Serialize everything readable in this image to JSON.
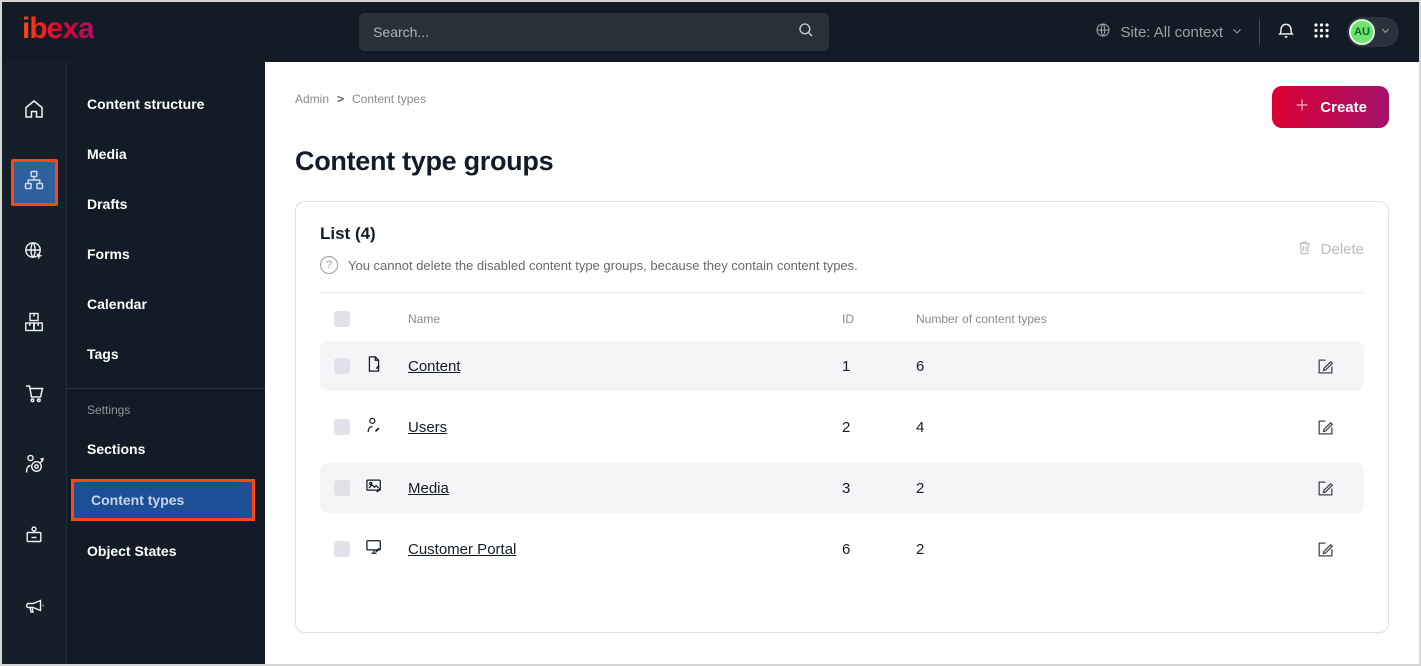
{
  "topbar": {
    "logo_text": "ibexa",
    "search_placeholder": "Search...",
    "site_context": "Site: All context",
    "avatar_initials": "AU"
  },
  "rail": {
    "items": [
      {
        "name": "home"
      },
      {
        "name": "content-structure",
        "active": true
      },
      {
        "name": "site"
      },
      {
        "name": "product-catalog"
      },
      {
        "name": "commerce"
      },
      {
        "name": "personalization"
      },
      {
        "name": "admin"
      },
      {
        "name": "marketing"
      }
    ]
  },
  "menu": {
    "items": [
      "Content structure",
      "Media",
      "Drafts",
      "Forms",
      "Calendar",
      "Tags"
    ],
    "settings_label": "Settings",
    "settings_items": [
      "Sections",
      "Content types",
      "Object States"
    ],
    "active_item": "Content types"
  },
  "breadcrumb": {
    "items": [
      "Admin",
      "Content types"
    ],
    "separator": ">"
  },
  "header": {
    "create_label": "Create",
    "page_title": "Content type groups"
  },
  "list": {
    "title": "List (4)",
    "help_glyph": "?",
    "info": "You cannot delete the disabled content type groups, because they contain content types.",
    "delete_label": "Delete",
    "columns": [
      "Name",
      "ID",
      "Number of content types"
    ],
    "rows": [
      {
        "icon": "file-edit-icon",
        "name": "Content",
        "id": "1",
        "count": "6"
      },
      {
        "icon": "user-edit-icon",
        "name": "Users",
        "id": "2",
        "count": "4"
      },
      {
        "icon": "image-edit-icon",
        "name": "Media",
        "id": "3",
        "count": "2"
      },
      {
        "icon": "monitor-edit-icon",
        "name": "Customer Portal",
        "id": "6",
        "count": "2"
      }
    ]
  },
  "colors": {
    "topbar_bg": "#131c26",
    "active_highlight_border": "#ff4713",
    "active_highlight_bg": "#1d4f97",
    "create_gradient_start": "#db0032",
    "create_gradient_end": "#a4126b",
    "avatar_green": "#6fe26f",
    "striped_row_bg": "#f5f5f8",
    "muted_text": "#878b90"
  }
}
